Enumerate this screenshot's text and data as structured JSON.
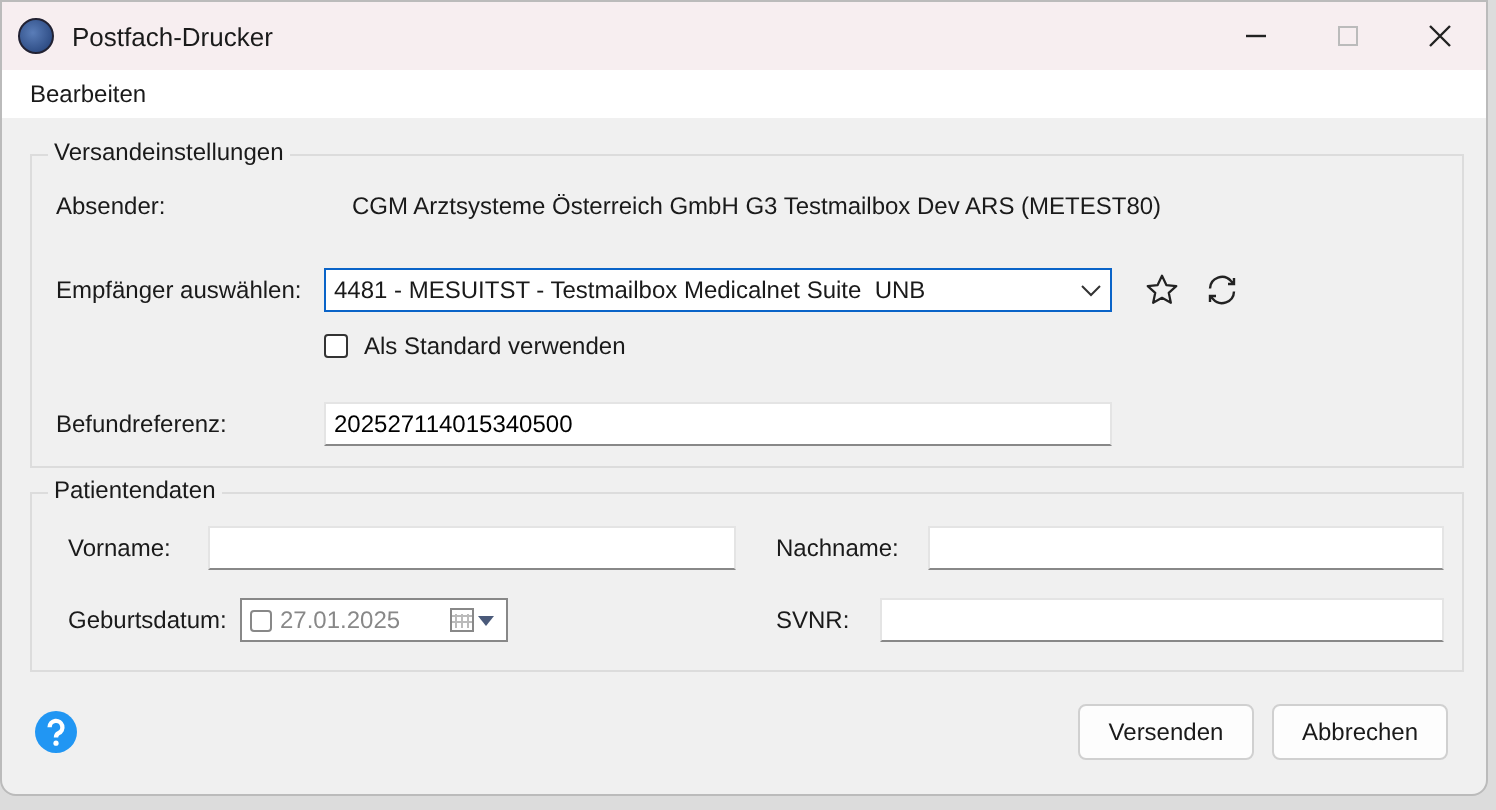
{
  "window": {
    "title": "Postfach-Drucker"
  },
  "menu": [
    {
      "label": "Bearbeiten"
    }
  ],
  "versand": {
    "title": "Versandeinstellungen",
    "sender": {
      "label": "Absender:",
      "value": "CGM Arztsysteme Österreich GmbH G3 Testmailbox Dev ARS (METEST80)"
    },
    "recipient": {
      "label": "Empfänger auswählen:",
      "value": "4481 - MESUITST - Testmailbox Medicalnet Suite  UNB"
    },
    "default_checkbox": {
      "label": "Als Standard verwenden",
      "checked": false
    },
    "reference": {
      "label": "Befundreferenz:",
      "value": "202527114015340500"
    }
  },
  "patient": {
    "title": "Patientendaten",
    "first_name": {
      "label": "Vorname:"
    },
    "last_name": {
      "label": "Nachname:"
    },
    "birth_date": {
      "label": "Geburtsdatum:",
      "value": "27.01.2025",
      "checked": false
    },
    "svnr": {
      "label": "SVNR:"
    }
  },
  "buttons": [
    {
      "label": "Versenden"
    },
    {
      "label": "Abbrechen"
    }
  ]
}
